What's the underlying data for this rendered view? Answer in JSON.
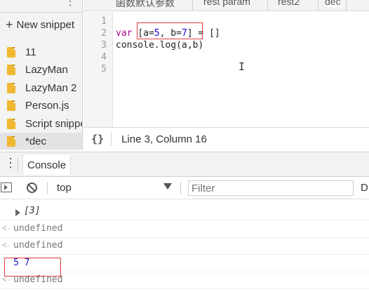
{
  "sidebar": {
    "new_snippet_label": "New snippet",
    "items": [
      {
        "label": "11"
      },
      {
        "label": "LazyMan"
      },
      {
        "label": "LazyMan 2"
      },
      {
        "label": "Person.js"
      },
      {
        "label": "Script snippet"
      },
      {
        "label": "*dec"
      }
    ]
  },
  "editor": {
    "tabs": [
      {
        "label": "函数默认参数"
      },
      {
        "label": "rest param"
      },
      {
        "label": "rest2"
      },
      {
        "label": "dec"
      }
    ],
    "line_numbers": [
      "1",
      "2",
      "3",
      "4",
      "5"
    ],
    "code": {
      "line2": {
        "kw": "var",
        "arr_open": "[a=",
        "n1": "5",
        "mid": ", b=",
        "n2": "7",
        "arr_close": "]",
        "rest": " = []"
      },
      "line3": "console.log(a,b)"
    },
    "status": {
      "braces": "{}",
      "cursor": "Line 3, Column 16"
    }
  },
  "drawer": {
    "tab_label": "Console"
  },
  "console_toolbar": {
    "context": "top",
    "filter_placeholder": "Filter",
    "levels": "D"
  },
  "console": {
    "messages": [
      {
        "text": "[3]"
      },
      {
        "prefix": "<·",
        "text": "undefined"
      },
      {
        "prefix": "<·",
        "text": "undefined"
      },
      {
        "text": "5 7"
      },
      {
        "prefix": "<·",
        "text": "undefined"
      }
    ]
  },
  "colors": {
    "highlight_box": "#e23b3b",
    "file_icon": "#f0b731",
    "keyword": "#aa0d91",
    "number": "#1c00cf"
  }
}
